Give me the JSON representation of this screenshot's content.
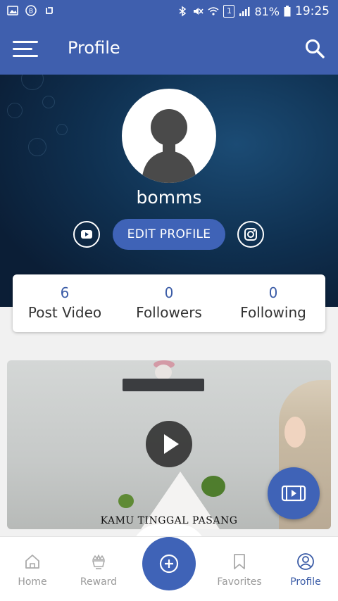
{
  "status_bar": {
    "left_icons": [
      "image-icon",
      "b-icon",
      "sync-icon"
    ],
    "signal_box": "1",
    "battery": "81%",
    "time": "19:25"
  },
  "app_bar": {
    "title": "Profile"
  },
  "profile": {
    "username": "bomms",
    "edit_button": "EDIT PROFILE",
    "stats": [
      {
        "value": "6",
        "label": "Post Video"
      },
      {
        "value": "0",
        "label": "Followers"
      },
      {
        "value": "0",
        "label": "Following"
      }
    ]
  },
  "video": {
    "caption": "KAMU TINGGAL PASANG"
  },
  "bottom_nav": {
    "items": [
      {
        "label": "Home",
        "icon": "home-icon"
      },
      {
        "label": "Reward",
        "icon": "reward-icon"
      },
      {
        "label": "Favorites",
        "icon": "bookmark-icon"
      },
      {
        "label": "Profile",
        "icon": "user-icon"
      }
    ]
  },
  "colors": {
    "primary": "#3f5fae",
    "accent": "#3f63b7",
    "active_text": "#3a5ba6"
  }
}
